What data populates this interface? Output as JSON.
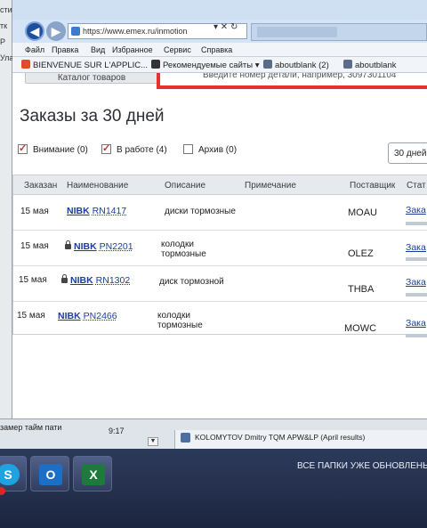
{
  "left_strip": [
    "стиі",
    "тк",
    "Р",
    "Ула"
  ],
  "browser": {
    "address": "https://www.emex.ru/inmotion",
    "address_ctrls": "▾ ✕ ↻",
    "menu": [
      "Файл",
      "Правка",
      "Вид",
      "Избранное",
      "Сервис",
      "Справка"
    ],
    "favorites": [
      {
        "label": "BIENVENUE SUR L'APPLIC...",
        "icon": "red-bookmark-icon",
        "color": "#c8311f"
      },
      {
        "label": "Рекомендуемые сайты ▾",
        "icon": "rss-icon",
        "color": "#222"
      },
      {
        "label": "aboutblank (2)",
        "icon": "ie-page-icon",
        "color": "#333"
      },
      {
        "label": "aboutblank",
        "icon": "ie-page-icon",
        "color": "#333"
      }
    ]
  },
  "page": {
    "catalog_button": "Каталог товаров",
    "part_search_placeholder": "Введите номер детали, например, 3097301104",
    "title": "Заказы за 30 дней",
    "filters": [
      {
        "label": "Внимание (0)",
        "checked": true
      },
      {
        "label": "В работе (4)",
        "checked": true
      },
      {
        "label": "Архив (0)",
        "checked": false
      }
    ],
    "period": "30 дней",
    "columns": [
      "Заказан",
      "Наименование",
      "Описание",
      "Примечание",
      "Поставщик",
      "Стат"
    ],
    "rows": [
      {
        "date": "15 мая",
        "locked": false,
        "brand": "NIBK",
        "number": "RN1417",
        "desc1": "диски тормозные",
        "desc2": "",
        "supplier": "MOAU",
        "status": "Зака"
      },
      {
        "date": "15 мая",
        "locked": true,
        "brand": "NIBK",
        "number": "PN2201",
        "desc1": "колодки",
        "desc2": "тормозные",
        "supplier": "OLEZ",
        "status": "Зака"
      },
      {
        "date": "15 мая",
        "locked": true,
        "brand": "NIBK",
        "number": "RN1302",
        "desc1": "диск тормозной",
        "desc2": "",
        "supplier": "THBA",
        "status": "Зака"
      },
      {
        "date": "15 мая",
        "locked": false,
        "brand": "NIBK",
        "number": "PN2466",
        "desc1": "колодки",
        "desc2": "тормозные",
        "supplier": "MOWC",
        "status": "Зака"
      }
    ]
  },
  "statusbar": {
    "left": "замер тайм пати",
    "time": "9:17",
    "message": "KOLOMYTOV Dmitry  TQM APW&LP (April results)"
  },
  "taskbar": {
    "apps": [
      {
        "name": "skype",
        "letter": "S",
        "color": "#1fa3e0"
      },
      {
        "name": "outlook",
        "letter": "O",
        "color": "#1c6fc4"
      },
      {
        "name": "excel",
        "letter": "X",
        "color": "#1e7a3c"
      }
    ],
    "notification": "ВСЕ ПАПКИ УЖЕ ОБНОВЛЕНЫ"
  }
}
